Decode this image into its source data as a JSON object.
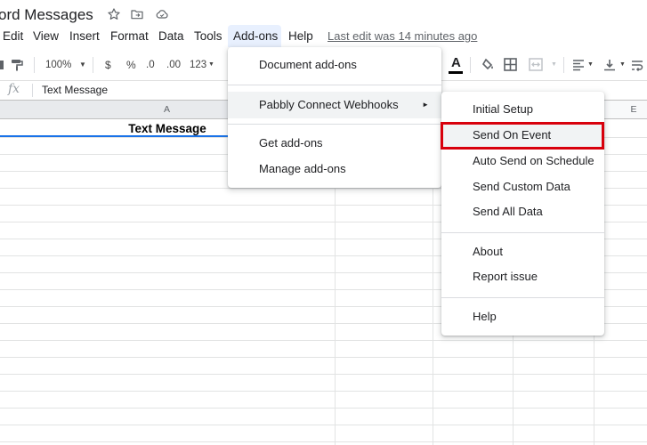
{
  "document": {
    "title": "ord Messages",
    "last_edit": "Last edit was 14 minutes ago"
  },
  "title_icons": [
    "star-icon",
    "move-folder-icon",
    "cloud-status-icon"
  ],
  "menubar": {
    "items": [
      "Edit",
      "View",
      "Insert",
      "Format",
      "Data",
      "Tools",
      "Add-ons",
      "Help"
    ],
    "active": "Add-ons"
  },
  "toolbar": {
    "zoom": "100%",
    "currency": "$",
    "percent": "%",
    "decrease_decimal": ".0",
    "increase_decimal": ".00",
    "more_formats": "123",
    "text_color_letter": "A"
  },
  "formula_bar": {
    "fx_label": "fx",
    "value": "Text Message"
  },
  "columns": {
    "a": "A",
    "e": "E"
  },
  "cells": {
    "a1": "Text Message"
  },
  "addons_menu": {
    "items": [
      "Document add-ons",
      "Pabbly Connect Webhooks",
      "Get add-ons",
      "Manage add-ons"
    ],
    "submenu_arrow": "►"
  },
  "webhooks_submenu": {
    "items": [
      "Initial Setup",
      "Send On Event",
      "Auto Send on Schedule",
      "Send Custom Data",
      "Send All Data",
      "About",
      "Report issue",
      "Help"
    ],
    "highlighted": "Send On Event"
  },
  "colors": {
    "highlight_border": "#d8000c",
    "selection_blue": "#1a73e8",
    "active_menu_bg": "#e8f0fe"
  }
}
